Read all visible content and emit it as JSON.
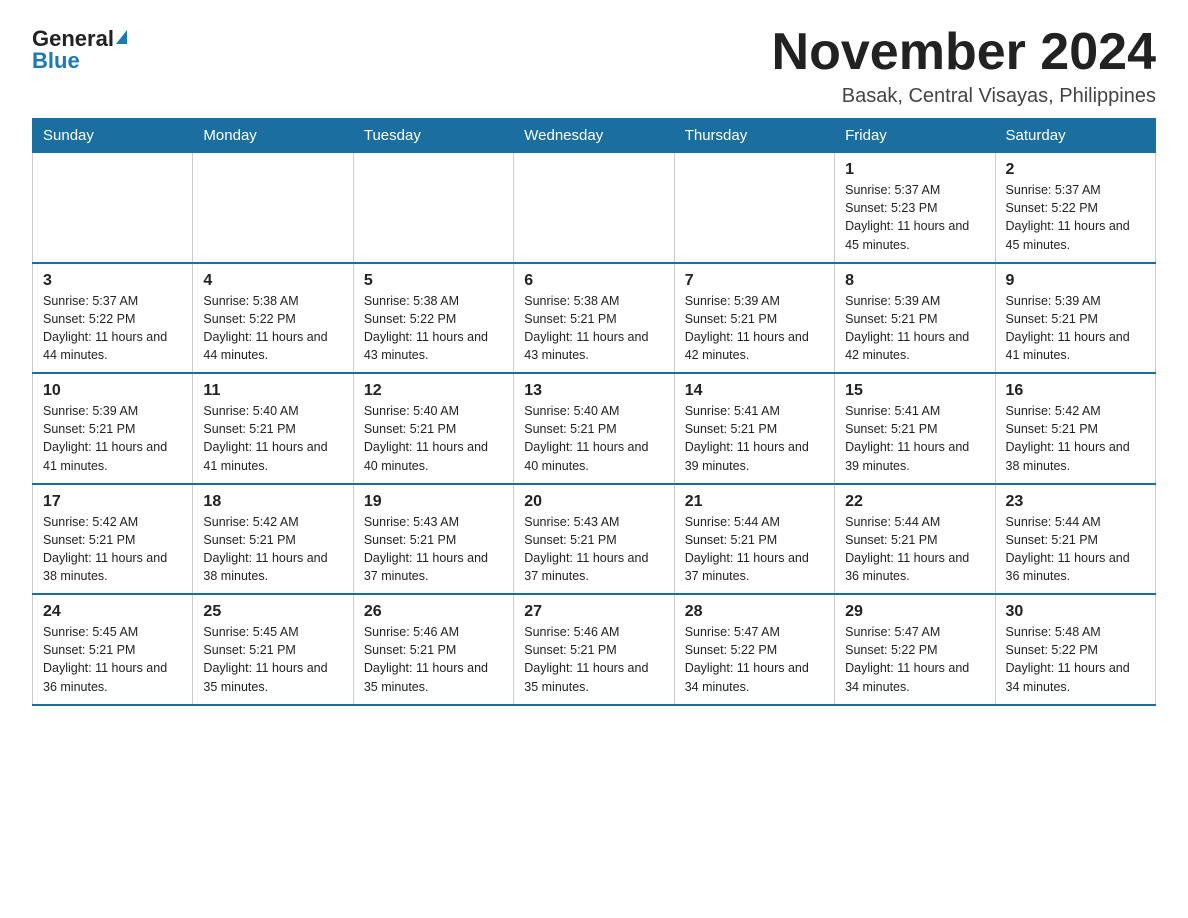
{
  "logo": {
    "general": "General",
    "blue": "Blue"
  },
  "header": {
    "month": "November 2024",
    "location": "Basak, Central Visayas, Philippines"
  },
  "weekdays": [
    "Sunday",
    "Monday",
    "Tuesday",
    "Wednesday",
    "Thursday",
    "Friday",
    "Saturday"
  ],
  "weeks": [
    [
      {
        "day": "",
        "info": ""
      },
      {
        "day": "",
        "info": ""
      },
      {
        "day": "",
        "info": ""
      },
      {
        "day": "",
        "info": ""
      },
      {
        "day": "",
        "info": ""
      },
      {
        "day": "1",
        "info": "Sunrise: 5:37 AM\nSunset: 5:23 PM\nDaylight: 11 hours and 45 minutes."
      },
      {
        "day": "2",
        "info": "Sunrise: 5:37 AM\nSunset: 5:22 PM\nDaylight: 11 hours and 45 minutes."
      }
    ],
    [
      {
        "day": "3",
        "info": "Sunrise: 5:37 AM\nSunset: 5:22 PM\nDaylight: 11 hours and 44 minutes."
      },
      {
        "day": "4",
        "info": "Sunrise: 5:38 AM\nSunset: 5:22 PM\nDaylight: 11 hours and 44 minutes."
      },
      {
        "day": "5",
        "info": "Sunrise: 5:38 AM\nSunset: 5:22 PM\nDaylight: 11 hours and 43 minutes."
      },
      {
        "day": "6",
        "info": "Sunrise: 5:38 AM\nSunset: 5:21 PM\nDaylight: 11 hours and 43 minutes."
      },
      {
        "day": "7",
        "info": "Sunrise: 5:39 AM\nSunset: 5:21 PM\nDaylight: 11 hours and 42 minutes."
      },
      {
        "day": "8",
        "info": "Sunrise: 5:39 AM\nSunset: 5:21 PM\nDaylight: 11 hours and 42 minutes."
      },
      {
        "day": "9",
        "info": "Sunrise: 5:39 AM\nSunset: 5:21 PM\nDaylight: 11 hours and 41 minutes."
      }
    ],
    [
      {
        "day": "10",
        "info": "Sunrise: 5:39 AM\nSunset: 5:21 PM\nDaylight: 11 hours and 41 minutes."
      },
      {
        "day": "11",
        "info": "Sunrise: 5:40 AM\nSunset: 5:21 PM\nDaylight: 11 hours and 41 minutes."
      },
      {
        "day": "12",
        "info": "Sunrise: 5:40 AM\nSunset: 5:21 PM\nDaylight: 11 hours and 40 minutes."
      },
      {
        "day": "13",
        "info": "Sunrise: 5:40 AM\nSunset: 5:21 PM\nDaylight: 11 hours and 40 minutes."
      },
      {
        "day": "14",
        "info": "Sunrise: 5:41 AM\nSunset: 5:21 PM\nDaylight: 11 hours and 39 minutes."
      },
      {
        "day": "15",
        "info": "Sunrise: 5:41 AM\nSunset: 5:21 PM\nDaylight: 11 hours and 39 minutes."
      },
      {
        "day": "16",
        "info": "Sunrise: 5:42 AM\nSunset: 5:21 PM\nDaylight: 11 hours and 38 minutes."
      }
    ],
    [
      {
        "day": "17",
        "info": "Sunrise: 5:42 AM\nSunset: 5:21 PM\nDaylight: 11 hours and 38 minutes."
      },
      {
        "day": "18",
        "info": "Sunrise: 5:42 AM\nSunset: 5:21 PM\nDaylight: 11 hours and 38 minutes."
      },
      {
        "day": "19",
        "info": "Sunrise: 5:43 AM\nSunset: 5:21 PM\nDaylight: 11 hours and 37 minutes."
      },
      {
        "day": "20",
        "info": "Sunrise: 5:43 AM\nSunset: 5:21 PM\nDaylight: 11 hours and 37 minutes."
      },
      {
        "day": "21",
        "info": "Sunrise: 5:44 AM\nSunset: 5:21 PM\nDaylight: 11 hours and 37 minutes."
      },
      {
        "day": "22",
        "info": "Sunrise: 5:44 AM\nSunset: 5:21 PM\nDaylight: 11 hours and 36 minutes."
      },
      {
        "day": "23",
        "info": "Sunrise: 5:44 AM\nSunset: 5:21 PM\nDaylight: 11 hours and 36 minutes."
      }
    ],
    [
      {
        "day": "24",
        "info": "Sunrise: 5:45 AM\nSunset: 5:21 PM\nDaylight: 11 hours and 36 minutes."
      },
      {
        "day": "25",
        "info": "Sunrise: 5:45 AM\nSunset: 5:21 PM\nDaylight: 11 hours and 35 minutes."
      },
      {
        "day": "26",
        "info": "Sunrise: 5:46 AM\nSunset: 5:21 PM\nDaylight: 11 hours and 35 minutes."
      },
      {
        "day": "27",
        "info": "Sunrise: 5:46 AM\nSunset: 5:21 PM\nDaylight: 11 hours and 35 minutes."
      },
      {
        "day": "28",
        "info": "Sunrise: 5:47 AM\nSunset: 5:22 PM\nDaylight: 11 hours and 34 minutes."
      },
      {
        "day": "29",
        "info": "Sunrise: 5:47 AM\nSunset: 5:22 PM\nDaylight: 11 hours and 34 minutes."
      },
      {
        "day": "30",
        "info": "Sunrise: 5:48 AM\nSunset: 5:22 PM\nDaylight: 11 hours and 34 minutes."
      }
    ]
  ]
}
